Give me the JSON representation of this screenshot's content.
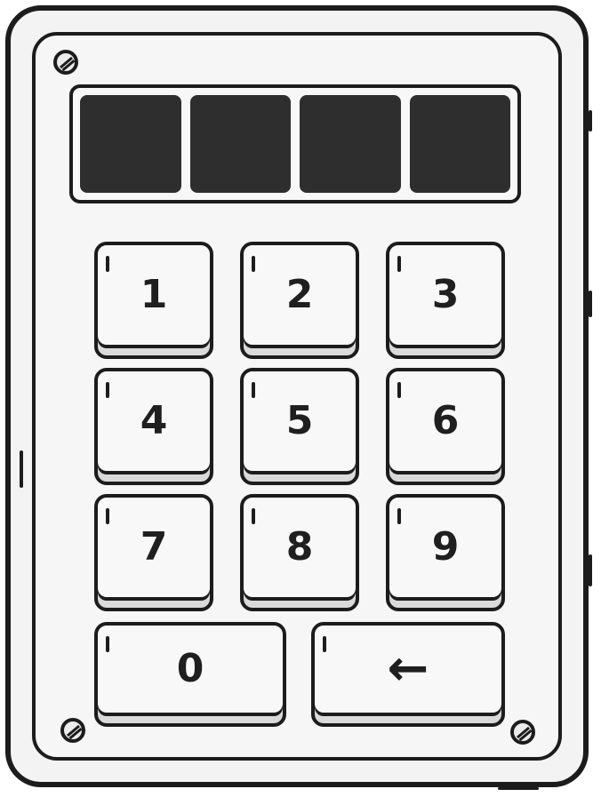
{
  "display": {
    "cells": 4
  },
  "keypad": {
    "rows": [
      [
        "1",
        "2",
        "3"
      ],
      [
        "4",
        "5",
        "6"
      ],
      [
        "7",
        "8",
        "9"
      ]
    ],
    "zero_label": "0",
    "backspace_label": "←"
  }
}
